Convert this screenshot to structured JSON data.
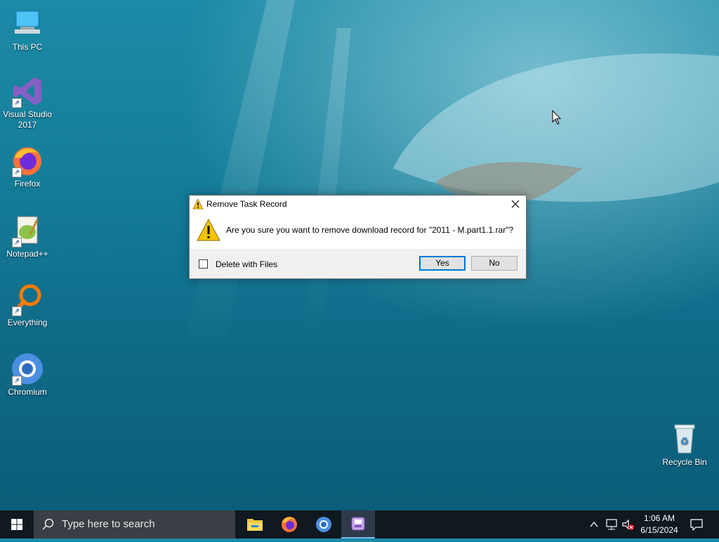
{
  "desktop": {
    "icons": [
      {
        "label": "This PC",
        "icon": "this-pc-icon"
      },
      {
        "label": "Visual Studio\n2017",
        "icon": "visual-studio-icon"
      },
      {
        "label": "Firefox",
        "icon": "firefox-icon"
      },
      {
        "label": "Notepad++",
        "icon": "notepad-plus-plus-icon"
      },
      {
        "label": "Everything",
        "icon": "everything-icon"
      },
      {
        "label": "Chromium",
        "icon": "chromium-icon"
      },
      {
        "label": "Recycle Bin",
        "icon": "recycle-bin-icon"
      }
    ]
  },
  "dialog": {
    "title": "Remove Task Record",
    "message": "Are you sure you want to remove download record for \"2011 - M.part1.1.rar\"?",
    "checkbox_label": "Delete with Files",
    "checkbox_checked": false,
    "yes_label": "Yes",
    "no_label": "No"
  },
  "taskbar": {
    "search_placeholder": "Type here to search",
    "pinned": [
      "file-explorer-icon",
      "firefox-icon",
      "chromium-icon",
      "download-manager-icon"
    ],
    "time": "1:06 AM",
    "date": "6/15/2024"
  },
  "colors": {
    "accent": "#0078d7",
    "taskbar": "#101820",
    "warning": "#f5c400"
  }
}
